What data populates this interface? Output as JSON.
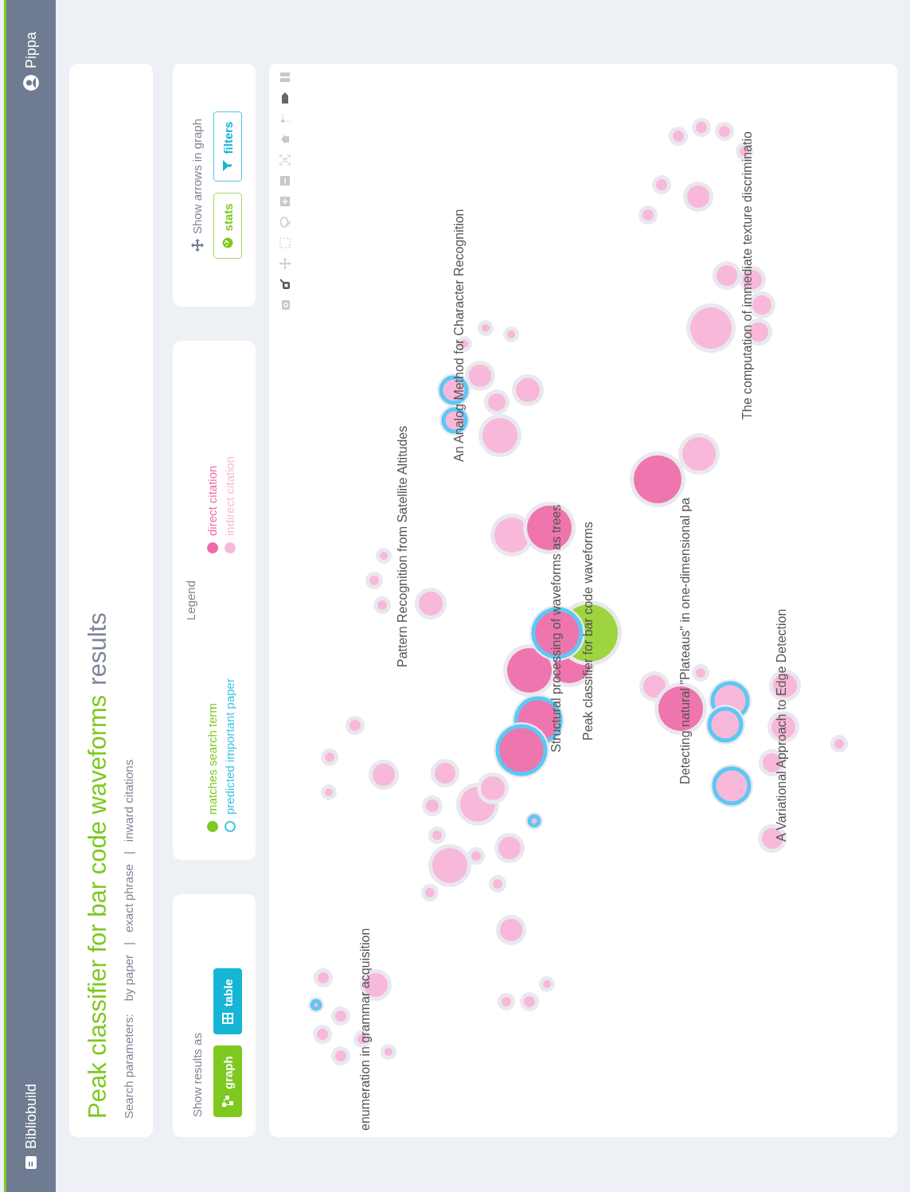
{
  "top_bar": {
    "app_name": "Bibliobuild",
    "user_name": "Pippa"
  },
  "search": {
    "query": "Peak classifier for bar code waveforms",
    "title_suffix": "results",
    "parameters_label": "Search parameters:",
    "separator": "|",
    "parameters": [
      "by paper",
      "exact phrase",
      "inward citations"
    ]
  },
  "view_options": {
    "label": "Show results as",
    "buttons": [
      {
        "label": "graph",
        "kind": "graph"
      },
      {
        "label": "table",
        "kind": "table"
      }
    ]
  },
  "legend": {
    "title": "Legend",
    "items": [
      {
        "label": "matches search term",
        "kind": "dot",
        "color": "#7ec820"
      },
      {
        "label": "predicted important paper",
        "kind": "ring",
        "color": "#3cc3e8"
      },
      {
        "label": "direct citation",
        "kind": "dot",
        "color": "#ee6aa8"
      },
      {
        "label": "indirect citation",
        "kind": "dot",
        "color": "#f8b8da"
      }
    ]
  },
  "graph_options": {
    "label": "Show arrows in graph",
    "buttons": [
      {
        "label": "stats",
        "kind": "stats"
      },
      {
        "label": "filters",
        "kind": "filters"
      }
    ]
  },
  "graph": {
    "node_labels": [
      "enumeration in grammar acquisition",
      "Pattern Recognition from Satellite Altitudes",
      "An Analog Method for Character Recognition",
      "Structural processing of waveforms as trees",
      "Peak classifier for bar code waveforms",
      "Detecting natural \"Plateaus\" in one-dimensional pa",
      "A Variational Approach to Edge Detection",
      "The computation of immediate texture discriminatio"
    ]
  }
}
